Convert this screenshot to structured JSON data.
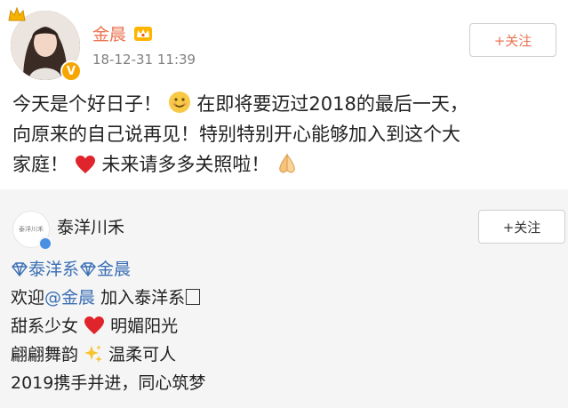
{
  "post": {
    "author_name": "金晨",
    "timestamp": "18-12-31 11:39",
    "follow_label": "+关注",
    "content": {
      "line1_a": "今天是个好日子！",
      "line1_b": "在即将要迈过2018的最后一天，",
      "line2": "向原来的自己说再见！特别特别开心能够加入到这个大",
      "line3_a": "家庭！",
      "line3_b": "未来请多多关照啦！"
    },
    "icons": {
      "crown": "crown-icon",
      "vip": "vip-crown-icon",
      "verified": "verified-v-icon",
      "smile": "smiling-face-emoji",
      "heart": "red-heart-emoji",
      "hands": "pressed-hands-emoji"
    },
    "colors": {
      "author": "#eb7350",
      "link": "#3b6fb5",
      "verified": "#f7a600"
    }
  },
  "repost": {
    "author_name": "泰洋川禾",
    "avatar_text": "泰洋川禾",
    "follow_label": "+关注",
    "topic1": "泰洋系",
    "topic2": "金晨",
    "line2_a": "欢迎",
    "mention": "@金晨",
    "line2_b": " 加入泰洋系",
    "line3_a": "甜系少女",
    "line3_b": " 明媚阳光",
    "line4_a": "翩翩舞韵",
    "line4_b": " 温柔可人",
    "line5": "2019携手并进，同心筑梦",
    "icons": {
      "diamond": "diamond-icon",
      "heart": "red-heart-emoji",
      "sparkles": "sparkles-emoji",
      "verified": "verified-blue-icon"
    }
  }
}
